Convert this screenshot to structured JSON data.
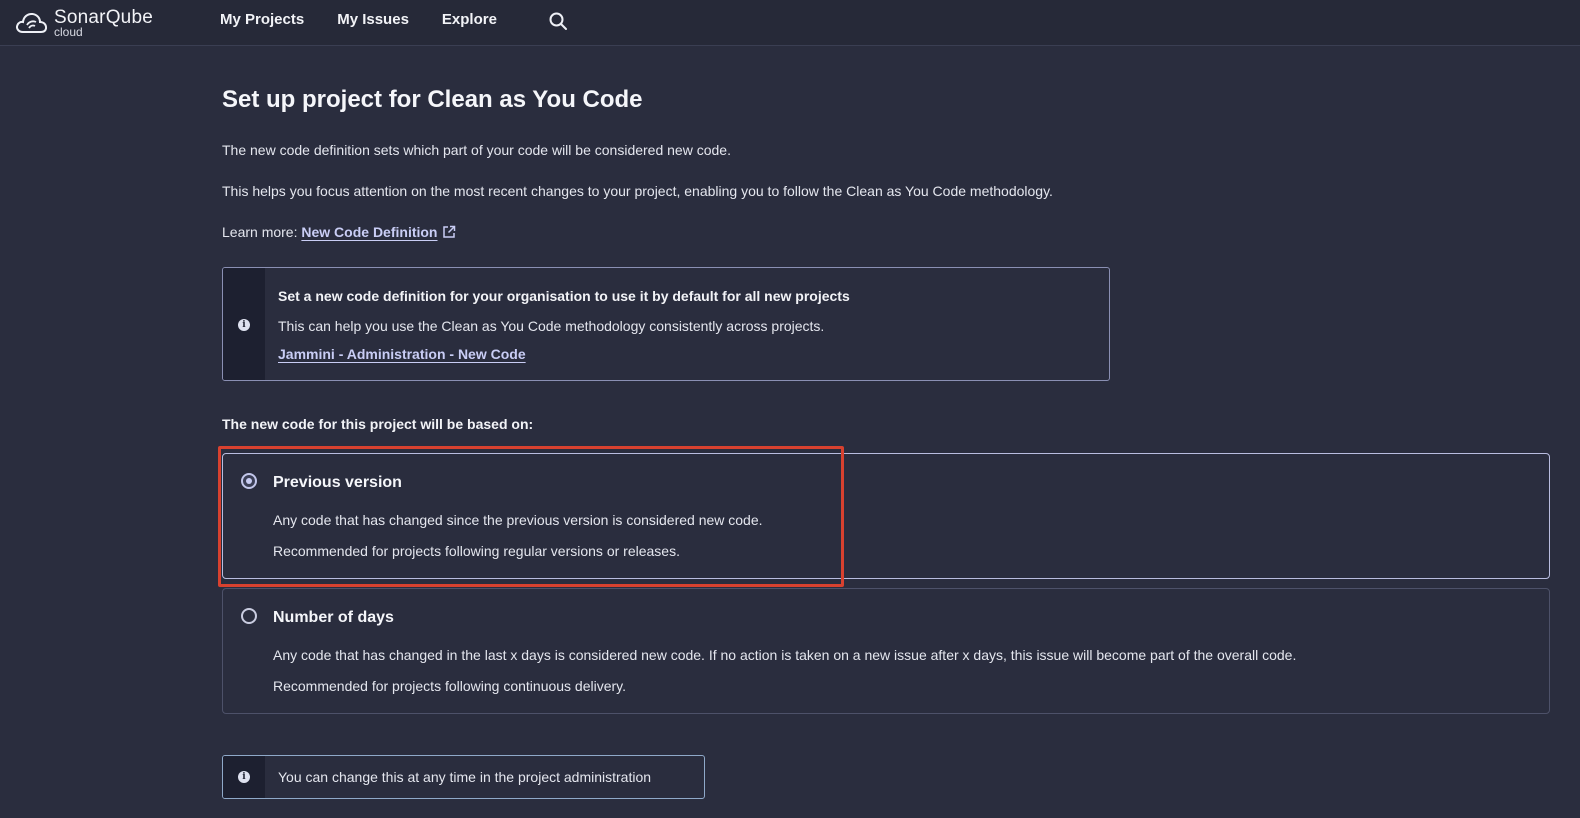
{
  "app": {
    "brand_name": "SonarQube",
    "brand_sub": "cloud"
  },
  "nav": {
    "items": [
      {
        "label": "My Projects"
      },
      {
        "label": "My Issues"
      },
      {
        "label": "Explore"
      }
    ],
    "search_icon": "search-icon"
  },
  "page": {
    "title": "Set up project for Clean as You Code",
    "intro": "The new code definition sets which part of your code will be considered new code.",
    "intro2": "This helps you focus attention on the most recent changes to your project, enabling you to follow the Clean as You Code methodology.",
    "learn_prefix": "Learn more:",
    "learn_link": "New Code Definition"
  },
  "banner": {
    "icon": "info-icon",
    "title": "Set a new code definition for your organisation to use it by default for all new projects",
    "description": "This can help you use the Clean as You Code methodology consistently across projects.",
    "link": "Jammini - Administration - New Code"
  },
  "options": {
    "heading": "The new code for this project will be based on:",
    "items": [
      {
        "title": "Previous version",
        "description": "Any code that has changed since the previous version is considered new code.",
        "recommendation": "Recommended for projects following regular versions or releases.",
        "selected": true
      },
      {
        "title": "Number of days",
        "description": "Any code that has changed in the last x days is considered new code. If no action is taken on a new issue after x days, this issue will become part of the overall code.",
        "recommendation": "Recommended for projects following continuous delivery.",
        "selected": false
      }
    ]
  },
  "note": {
    "icon": "info-icon",
    "text": "You can change this at any time in the project administration"
  },
  "colors": {
    "background": "#2a2d3e",
    "link": "#c9cdf5",
    "highlight": "#d8412f"
  }
}
